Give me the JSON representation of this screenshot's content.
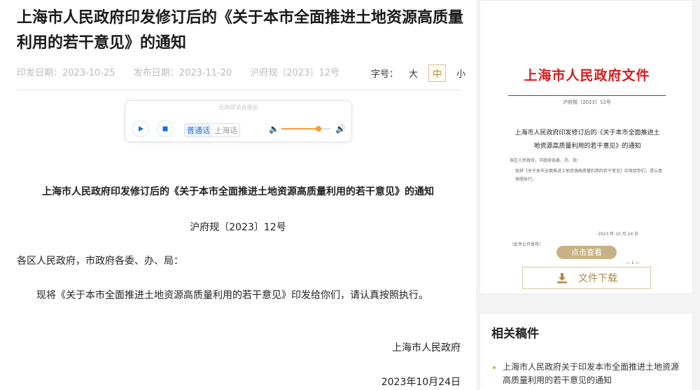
{
  "article": {
    "title": "上海市人民政府印发修订后的《关于本市全面推进土地资源高质量利用的若干意见》的通知",
    "issue_date": "印发日期：2023-10-25",
    "publish_date": "发布日期：2023-11-20",
    "doc_number": "沪府规〔2023〕12号",
    "font_size_label": "字号：",
    "font_sizes": [
      "大",
      "中",
      "小"
    ],
    "font_size_selected": "中"
  },
  "player": {
    "caption": "无障碍语音播报",
    "languages": [
      "普通话",
      "上海话"
    ],
    "language_selected": "普通话",
    "volume": 0.75,
    "colors": {
      "accent": "#1e6fd9",
      "volume": "#f29d38"
    }
  },
  "body": {
    "heading": "上海市人民政府印发修订后的《关于本市全面推进土地资源高质量利用的若干意见》的通知",
    "doc_number": "沪府规〔2023〕12号",
    "addressee": "各区人民政府，市政府各委、办、局：",
    "paragraph": "现将《关于本市全面推进土地资源高质量利用的若干意见》印发给你们，请认真按照执行。",
    "signer": "上海市人民政府",
    "sign_date": "2023年10月24日"
  },
  "preview": {
    "doc_header": "上海市人民政府文件",
    "doc_number": "沪府规〔2023〕12号",
    "doc_title": "上海市人民政府印发修订后的《关于本市全面推进土地资源高质量利用的若干意见》的通知",
    "addressee": "各区人民政府，市政府各委、办、局：",
    "paragraph": "现将《关于本市全面推进土地资源高质量利用的若干意见》印发给你们，请认真按照执行。",
    "date": "2023 年 10 月 24 日",
    "publicity": "（此件公开发布）",
    "page": "— 1 —",
    "view_button": "点击查看",
    "download_button": "文件下载",
    "colors": {
      "header_red": "#d51b1b",
      "gold": "#c8b285"
    }
  },
  "related": {
    "title": "相关稿件",
    "items": [
      "上海市人民政府关于印发本市全面推进土地资源高质量利用的若干意见的通知"
    ]
  }
}
